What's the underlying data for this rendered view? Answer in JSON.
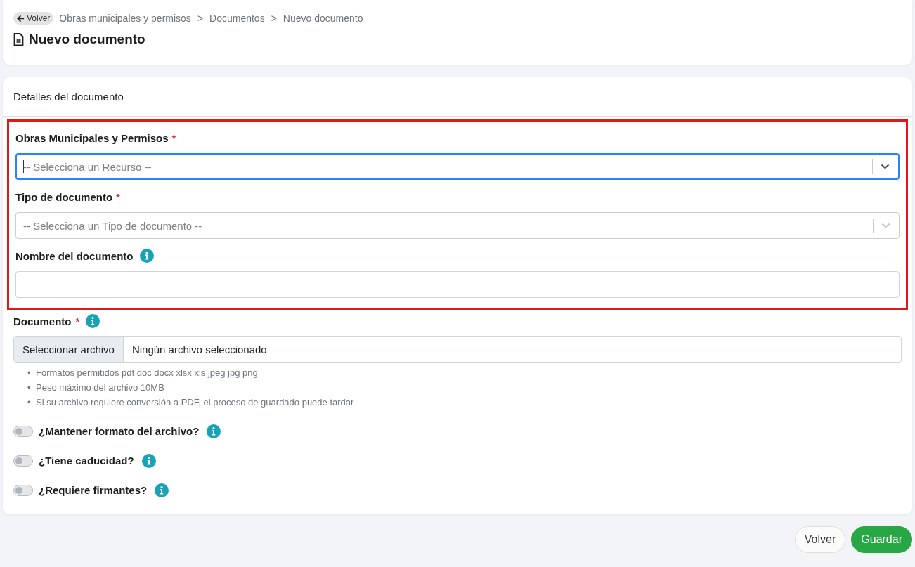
{
  "header": {
    "back_button": "Volver",
    "breadcrumb": [
      {
        "kind": "link",
        "text": "Obras municipales y permisos"
      },
      {
        "kind": "separator",
        "text": ">"
      },
      {
        "kind": "link",
        "text": "Documentos"
      },
      {
        "kind": "separator",
        "text": ">"
      },
      {
        "kind": "current",
        "text": "Nuevo documento"
      }
    ],
    "title": "Nuevo documento"
  },
  "form": {
    "title": "Detalles del documento",
    "highlighted_group": {
      "highlighted": true,
      "fields": [
        {
          "kind": "select",
          "label": "Obras Municipales y Permisos",
          "required_mark": "*",
          "info": false,
          "placeholder": "-- Selecciona un Recurso --",
          "focused": true
        },
        {
          "kind": "select",
          "label": "Tipo de documento",
          "required_mark": "*",
          "info": false,
          "placeholder": "-- Selecciona un Tipo de documento --",
          "focused": false
        },
        {
          "kind": "text",
          "label": "Nombre del documento",
          "info": true,
          "focused": false
        }
      ]
    },
    "file_field": {
      "label": "Documento",
      "required_mark": "*",
      "info": true,
      "button": "Seleccionar archivo",
      "value": "Ningún archivo seleccionado",
      "hints": [
        {
          "bullet": "•",
          "text": "Formatos permitidos pdf doc docx xlsx xls jpeg jpg png"
        },
        {
          "bullet": "•",
          "text": "Peso máximo del archivo 10MB"
        },
        {
          "bullet": "•",
          "text": "Si su archivo requiere conversión a PDF, el proceso de guardado puede tardar"
        }
      ]
    },
    "toggles": [
      {
        "label": "¿Mantener formato del archivo?",
        "on": false,
        "info": true
      },
      {
        "label": "¿Tiene caducidad?",
        "on": false,
        "info": true
      },
      {
        "label": "¿Requiere firmantes?",
        "on": false,
        "info": true
      }
    ]
  },
  "buttons": [
    {
      "label": "Volver",
      "kind": "secondary"
    },
    {
      "label": "Guardar",
      "kind": "primary"
    }
  ]
}
